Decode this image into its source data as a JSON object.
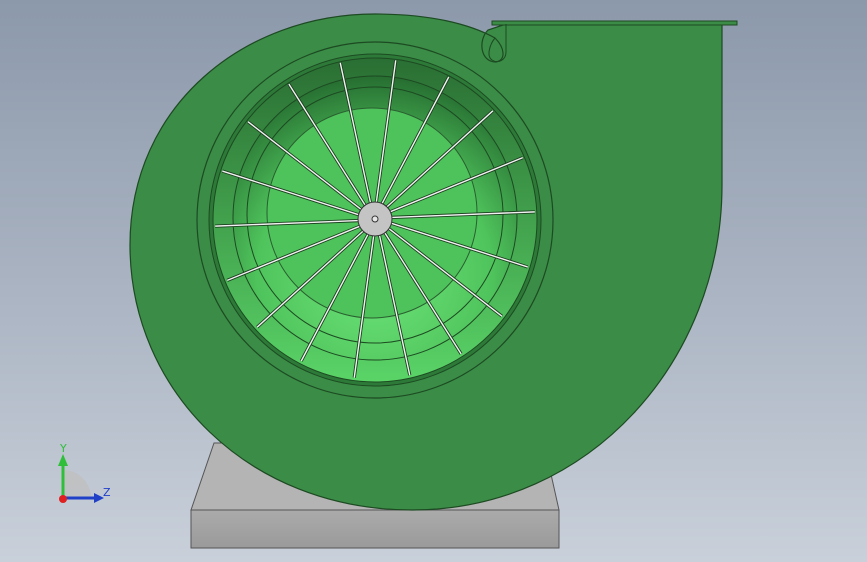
{
  "viewport": {
    "background_top": "#8c99ab",
    "background_bottom": "#c9d0da"
  },
  "model": {
    "housing_color": "#3a8c46",
    "housing_outline": "#1d4a22",
    "impeller_inner_color": "#5fd66c",
    "impeller_dark_color": "#2f7a3a",
    "hub_color": "#c4c4c4",
    "base_color": "#a9a9a9",
    "base_outline": "#4a4a4a",
    "blade_count": 18
  },
  "triad": {
    "y_label": "Y",
    "z_label": "Z",
    "y_color": "#2fbf3a",
    "z_color": "#2040c8",
    "x_color": "#e02020"
  }
}
